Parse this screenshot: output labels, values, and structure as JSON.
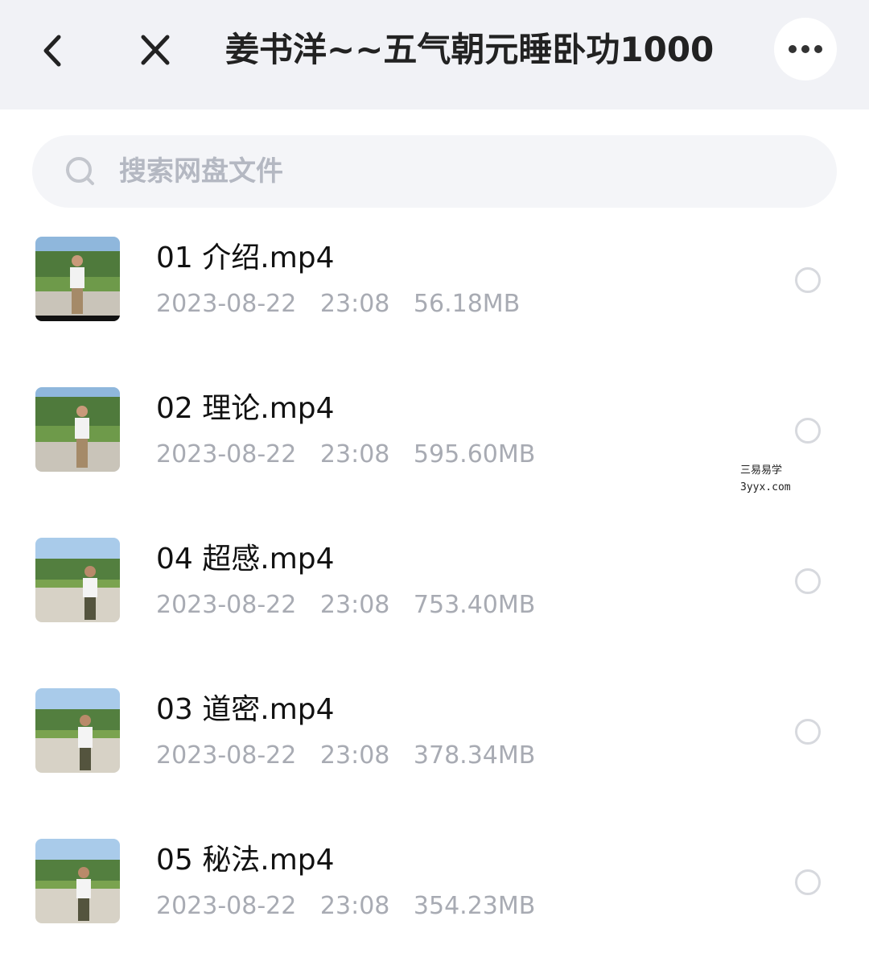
{
  "header": {
    "back_icon": "chevron-left-icon",
    "close_icon": "close-icon",
    "title": "姜书洋~~五气朝元睡卧功1000",
    "more_icon": "more-horizontal-icon"
  },
  "search": {
    "icon": "search-icon",
    "placeholder": "搜索网盘文件"
  },
  "files": [
    {
      "name": "01 介绍.mp4",
      "date": "2023-08-22",
      "time": "23:08",
      "size": "56.18MB"
    },
    {
      "name": "02 理论.mp4",
      "date": "2023-08-22",
      "time": "23:08",
      "size": "595.60MB"
    },
    {
      "name": "04 超感.mp4",
      "date": "2023-08-22",
      "time": "23:08",
      "size": "753.40MB"
    },
    {
      "name": "03 道密.mp4",
      "date": "2023-08-22",
      "time": "23:08",
      "size": "378.34MB"
    },
    {
      "name": "05 秘法.mp4",
      "date": "2023-08-22",
      "time": "23:08",
      "size": "354.23MB"
    }
  ],
  "watermark": {
    "line1": "三易易学",
    "line2": "3yyx.com"
  },
  "colors": {
    "header_bg": "#f1f2f6",
    "meta_text": "#a8abb3",
    "search_bg": "#f4f5f8"
  }
}
